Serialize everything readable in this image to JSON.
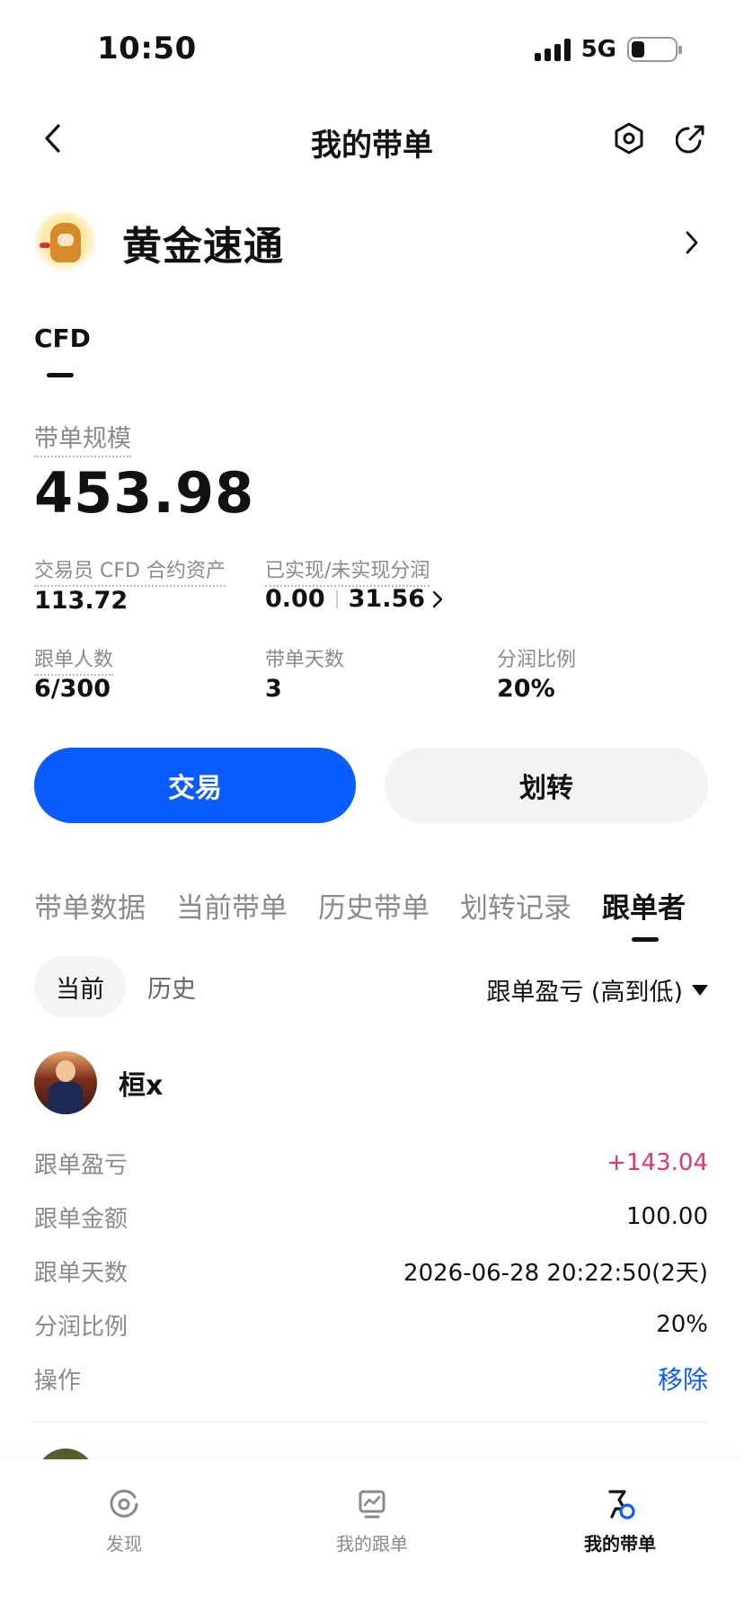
{
  "status_bar": {
    "time": "10:50",
    "network": "5G"
  },
  "nav": {
    "title": "我的带单"
  },
  "trader": {
    "name": "黄金速通"
  },
  "market_tab": "CFD",
  "scale": {
    "label": "带单规模",
    "value": "453.98"
  },
  "stats": {
    "assets_label": "交易员 CFD 合约资产",
    "assets_value": "113.72",
    "profit_label": "已实现/未实现分润",
    "realized": "0.00",
    "unrealized": "31.56",
    "followers_label": "跟单人数",
    "followers_value": "6/300",
    "days_label": "带单天数",
    "days_value": "3",
    "share_label": "分润比例",
    "share_value": "20%"
  },
  "buttons": {
    "trade": "交易",
    "transfer": "划转"
  },
  "tabs": [
    {
      "label": "带单数据"
    },
    {
      "label": "当前带单"
    },
    {
      "label": "历史带单"
    },
    {
      "label": "划转记录"
    },
    {
      "label": "跟单者"
    }
  ],
  "subtabs": [
    {
      "label": "当前"
    },
    {
      "label": "历史"
    }
  ],
  "sort": {
    "label": "跟单盈亏 (高到低)"
  },
  "follower": {
    "name": "桓x",
    "rows": [
      {
        "label": "跟单盈亏",
        "value": "+143.04"
      },
      {
        "label": "跟单金额",
        "value": "100.00"
      },
      {
        "label": "跟单天数",
        "value": "2026-06-28 20:22:50(2天)"
      },
      {
        "label": "分润比例",
        "value": "20%"
      },
      {
        "label": "操作",
        "value": "移除"
      }
    ]
  },
  "bottom_nav": [
    {
      "label": "发现",
      "icon": "discover-icon"
    },
    {
      "label": "我的跟单",
      "icon": "chart-board-icon"
    },
    {
      "label": "我的带单",
      "icon": "flag-badge-icon"
    }
  ],
  "colors": {
    "accent": "#0a5cff",
    "profit": "#e8336c",
    "muted": "#8a8a8a"
  }
}
